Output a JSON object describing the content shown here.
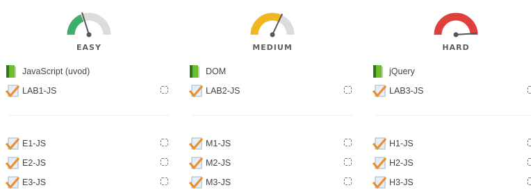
{
  "columns": [
    {
      "level": "EASY",
      "gauge_color": "#3fae6a",
      "book": "JavaScript (uvod)",
      "lab": "LAB1-JS",
      "tasks": [
        "E1-JS",
        "E2-JS",
        "E3-JS"
      ]
    },
    {
      "level": "MEDIUM",
      "gauge_color": "#f1b620",
      "book": "DOM",
      "lab": "LAB2-JS",
      "tasks": [
        "M1-JS",
        "M2-JS",
        "M3-JS"
      ]
    },
    {
      "level": "HARD",
      "gauge_color": "#e0403d",
      "book": "jQuery",
      "lab": "LAB3-JS",
      "tasks": [
        "H1-JS",
        "H2-JS",
        "H3-JS"
      ]
    }
  ],
  "icons": {
    "book": "book-icon",
    "assignment": "assignment-check-icon",
    "completion": "completion-checkbox-icon"
  }
}
